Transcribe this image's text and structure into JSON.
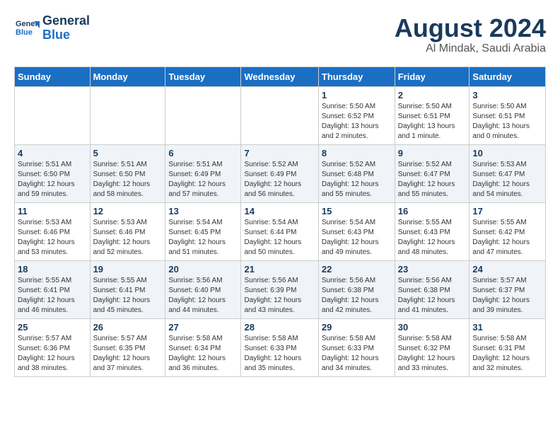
{
  "header": {
    "logo_line1": "General",
    "logo_line2": "Blue",
    "month": "August 2024",
    "location": "Al Mindak, Saudi Arabia"
  },
  "weekdays": [
    "Sunday",
    "Monday",
    "Tuesday",
    "Wednesday",
    "Thursday",
    "Friday",
    "Saturday"
  ],
  "weeks": [
    [
      {
        "day": "",
        "info": ""
      },
      {
        "day": "",
        "info": ""
      },
      {
        "day": "",
        "info": ""
      },
      {
        "day": "",
        "info": ""
      },
      {
        "day": "1",
        "info": "Sunrise: 5:50 AM\nSunset: 6:52 PM\nDaylight: 13 hours\nand 2 minutes."
      },
      {
        "day": "2",
        "info": "Sunrise: 5:50 AM\nSunset: 6:51 PM\nDaylight: 13 hours\nand 1 minute."
      },
      {
        "day": "3",
        "info": "Sunrise: 5:50 AM\nSunset: 6:51 PM\nDaylight: 13 hours\nand 0 minutes."
      }
    ],
    [
      {
        "day": "4",
        "info": "Sunrise: 5:51 AM\nSunset: 6:50 PM\nDaylight: 12 hours\nand 59 minutes."
      },
      {
        "day": "5",
        "info": "Sunrise: 5:51 AM\nSunset: 6:50 PM\nDaylight: 12 hours\nand 58 minutes."
      },
      {
        "day": "6",
        "info": "Sunrise: 5:51 AM\nSunset: 6:49 PM\nDaylight: 12 hours\nand 57 minutes."
      },
      {
        "day": "7",
        "info": "Sunrise: 5:52 AM\nSunset: 6:49 PM\nDaylight: 12 hours\nand 56 minutes."
      },
      {
        "day": "8",
        "info": "Sunrise: 5:52 AM\nSunset: 6:48 PM\nDaylight: 12 hours\nand 55 minutes."
      },
      {
        "day": "9",
        "info": "Sunrise: 5:52 AM\nSunset: 6:47 PM\nDaylight: 12 hours\nand 55 minutes."
      },
      {
        "day": "10",
        "info": "Sunrise: 5:53 AM\nSunset: 6:47 PM\nDaylight: 12 hours\nand 54 minutes."
      }
    ],
    [
      {
        "day": "11",
        "info": "Sunrise: 5:53 AM\nSunset: 6:46 PM\nDaylight: 12 hours\nand 53 minutes."
      },
      {
        "day": "12",
        "info": "Sunrise: 5:53 AM\nSunset: 6:46 PM\nDaylight: 12 hours\nand 52 minutes."
      },
      {
        "day": "13",
        "info": "Sunrise: 5:54 AM\nSunset: 6:45 PM\nDaylight: 12 hours\nand 51 minutes."
      },
      {
        "day": "14",
        "info": "Sunrise: 5:54 AM\nSunset: 6:44 PM\nDaylight: 12 hours\nand 50 minutes."
      },
      {
        "day": "15",
        "info": "Sunrise: 5:54 AM\nSunset: 6:43 PM\nDaylight: 12 hours\nand 49 minutes."
      },
      {
        "day": "16",
        "info": "Sunrise: 5:55 AM\nSunset: 6:43 PM\nDaylight: 12 hours\nand 48 minutes."
      },
      {
        "day": "17",
        "info": "Sunrise: 5:55 AM\nSunset: 6:42 PM\nDaylight: 12 hours\nand 47 minutes."
      }
    ],
    [
      {
        "day": "18",
        "info": "Sunrise: 5:55 AM\nSunset: 6:41 PM\nDaylight: 12 hours\nand 46 minutes."
      },
      {
        "day": "19",
        "info": "Sunrise: 5:55 AM\nSunset: 6:41 PM\nDaylight: 12 hours\nand 45 minutes."
      },
      {
        "day": "20",
        "info": "Sunrise: 5:56 AM\nSunset: 6:40 PM\nDaylight: 12 hours\nand 44 minutes."
      },
      {
        "day": "21",
        "info": "Sunrise: 5:56 AM\nSunset: 6:39 PM\nDaylight: 12 hours\nand 43 minutes."
      },
      {
        "day": "22",
        "info": "Sunrise: 5:56 AM\nSunset: 6:38 PM\nDaylight: 12 hours\nand 42 minutes."
      },
      {
        "day": "23",
        "info": "Sunrise: 5:56 AM\nSunset: 6:38 PM\nDaylight: 12 hours\nand 41 minutes."
      },
      {
        "day": "24",
        "info": "Sunrise: 5:57 AM\nSunset: 6:37 PM\nDaylight: 12 hours\nand 39 minutes."
      }
    ],
    [
      {
        "day": "25",
        "info": "Sunrise: 5:57 AM\nSunset: 6:36 PM\nDaylight: 12 hours\nand 38 minutes."
      },
      {
        "day": "26",
        "info": "Sunrise: 5:57 AM\nSunset: 6:35 PM\nDaylight: 12 hours\nand 37 minutes."
      },
      {
        "day": "27",
        "info": "Sunrise: 5:58 AM\nSunset: 6:34 PM\nDaylight: 12 hours\nand 36 minutes."
      },
      {
        "day": "28",
        "info": "Sunrise: 5:58 AM\nSunset: 6:33 PM\nDaylight: 12 hours\nand 35 minutes."
      },
      {
        "day": "29",
        "info": "Sunrise: 5:58 AM\nSunset: 6:33 PM\nDaylight: 12 hours\nand 34 minutes."
      },
      {
        "day": "30",
        "info": "Sunrise: 5:58 AM\nSunset: 6:32 PM\nDaylight: 12 hours\nand 33 minutes."
      },
      {
        "day": "31",
        "info": "Sunrise: 5:58 AM\nSunset: 6:31 PM\nDaylight: 12 hours\nand 32 minutes."
      }
    ]
  ]
}
